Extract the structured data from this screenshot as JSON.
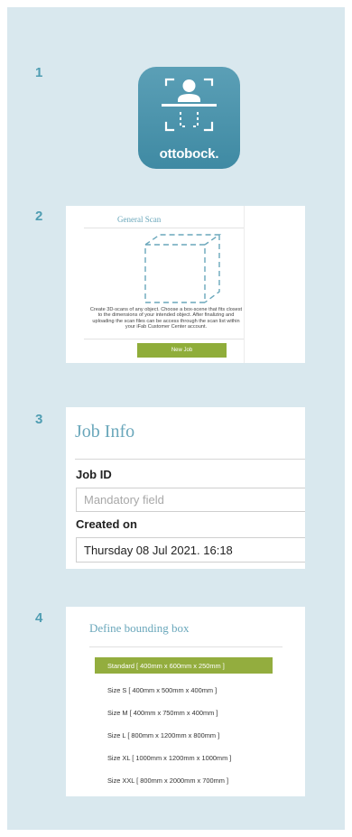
{
  "steps": {
    "s1": "1",
    "s2": "2",
    "s3": "3",
    "s4": "4"
  },
  "logo": {
    "brand": "ottobock.",
    "bg_color": "#4a93ab"
  },
  "general_scan": {
    "title": "General Scan",
    "description": "Create 3D-scans of any object. Choose a box-scene that fits closest to the dimensions of your intended object. After finalizing and uploading the scan files can be access through the scan list within your iFab Customer Center account.",
    "new_job_button": "New Job"
  },
  "job_info": {
    "title": "Job Info",
    "job_id_label": "Job ID",
    "job_id_placeholder": "Mandatory field",
    "created_on_label": "Created on",
    "created_on_value": "Thursday 08 Jul 2021. 16:18"
  },
  "bounding_box": {
    "title": "Define bounding box",
    "options": [
      "Standard [ 400mm x 600mm x 250mm ]",
      "Size S [ 400mm x 500mm x 400mm ]",
      "Size M [ 400mm x 750mm x 400mm ]",
      "Size L [ 800mm x 1200mm x 800mm ]",
      "Size XL [ 1000mm x 1200mm x 1000mm ]",
      "Size XXL [ 800mm x 2000mm x 700mm ]"
    ],
    "selected_index": 0
  },
  "colors": {
    "panel_bg": "#d9e8ee",
    "accent_blue": "#6aa7bb",
    "accent_green": "#93ad3e",
    "step_number": "#4f9db2"
  }
}
